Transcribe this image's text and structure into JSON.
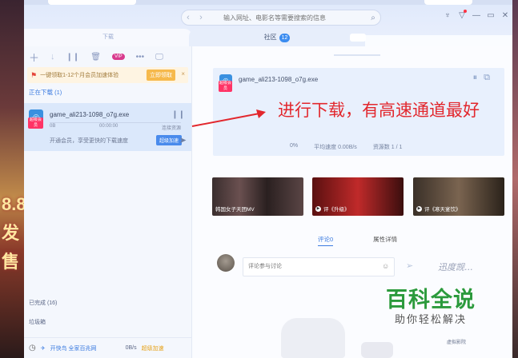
{
  "address_bar": {
    "placeholder": "输入网址、电影名等需要搜索的信息"
  },
  "subtabs": {
    "download": "下载",
    "community": "社区",
    "community_count": "12"
  },
  "toolbar": {
    "vip_badge": "VIP"
  },
  "promo": {
    "text": "一键领取1-12个月会员加速体验",
    "action": "立即领取",
    "close": "×"
  },
  "downloading": {
    "title": "正在下载 (1)"
  },
  "task": {
    "filename": "game_ali213-1098_o7g.exe",
    "size": "0B",
    "time": "00:00:00",
    "status": "连接资源",
    "info": "开通会员，享受更快的下载速度",
    "speed_button": "超级加速",
    "icon_tag": "超级会员"
  },
  "detail": {
    "filename": "game_ali213-1098_o7g.exe",
    "progress": "0%",
    "avg_speed": "平均速度 0.00B/s",
    "resources": "资源数 1 / 1"
  },
  "annotation": {
    "text": "进行下载，有高速通道最好"
  },
  "videos": [
    {
      "label": "韩国女子天团MV"
    },
    {
      "label": "评《升级》"
    },
    {
      "label": "评《寒天宴饮》"
    }
  ],
  "comment_tabs": {
    "comments": "评论0",
    "properties": "属性详情"
  },
  "comment": {
    "placeholder": "评论参与讨论",
    "signature": "迅度觊..."
  },
  "left_bottom": {
    "done": "已完成 (16)",
    "trash": "垃圾箱"
  },
  "footer": {
    "service": "开快鸟 全家百兆网",
    "speed": "0B/s",
    "boost": "超级加速"
  },
  "watermark": {
    "big": "百科全说",
    "small": "助你轻松解决"
  },
  "float_label": "虚拟影院",
  "bg_promo": "8.8\n发售",
  "colors": {
    "accent": "#3b7be0",
    "annotation": "#e2272d",
    "watermark": "#2b9a3c"
  }
}
